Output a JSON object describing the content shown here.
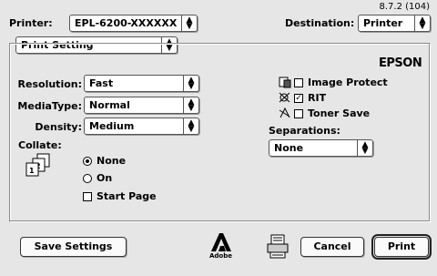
{
  "version": "8.7.2 (104)",
  "printer": {
    "label": "Printer:",
    "value": "EPL-6200-XXXXXX"
  },
  "destination": {
    "label": "Destination:",
    "value": "Printer"
  },
  "panel_selector": {
    "value": "Print Setting"
  },
  "brand": "EPSON",
  "resolution": {
    "label": "Resolution:",
    "value": "Fast"
  },
  "media_type": {
    "label": "MediaType:",
    "value": "Normal"
  },
  "density": {
    "label": "Density:",
    "value": "Medium"
  },
  "collate": {
    "label": "Collate:",
    "options": [
      {
        "label": "None",
        "selected": true
      },
      {
        "label": "On",
        "selected": false
      }
    ],
    "start_page": {
      "label": "Start Page",
      "checked": false
    }
  },
  "image_protect": {
    "label": "Image Protect",
    "checked": false
  },
  "rit": {
    "label": "RIT",
    "checked": true
  },
  "toner_save": {
    "label": "Toner Save",
    "checked": false
  },
  "separations": {
    "label": "Separations:",
    "value": "None"
  },
  "footer": {
    "save_settings": "Save Settings",
    "cancel": "Cancel",
    "print": "Print",
    "adobe_text": "Adobe"
  }
}
